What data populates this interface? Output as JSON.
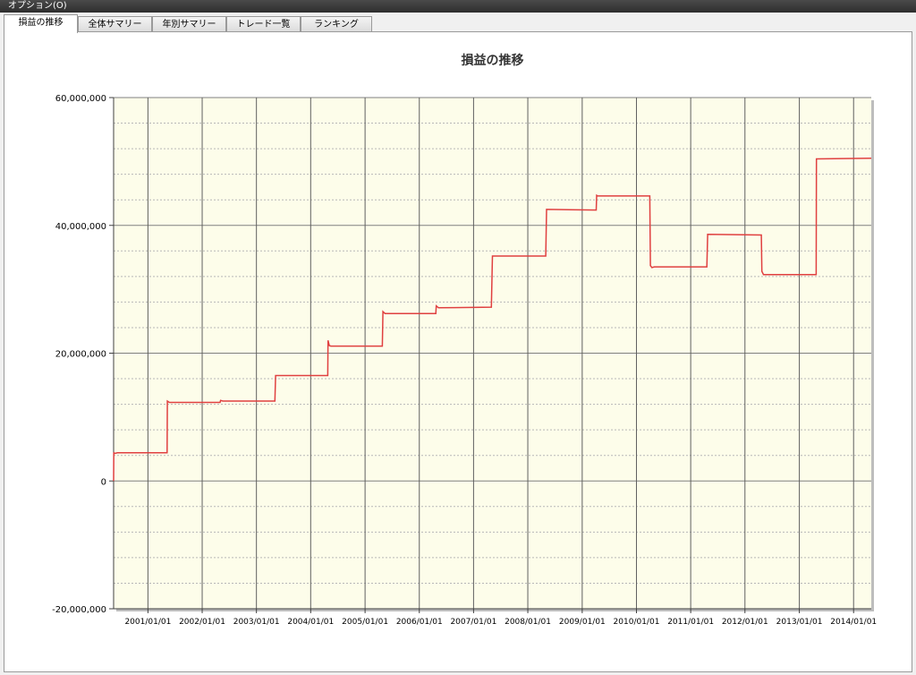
{
  "menu": {
    "options_label": "オプション(O)"
  },
  "tabs": [
    {
      "label": "損益の推移",
      "active": true
    },
    {
      "label": "全体サマリー",
      "active": false
    },
    {
      "label": "年別サマリー",
      "active": false
    },
    {
      "label": "トレード一覧",
      "active": false
    },
    {
      "label": "ランキング",
      "active": false
    }
  ],
  "colors": {
    "plot_background": "#fdfdea",
    "line": "#e04040",
    "grid": "#808080"
  },
  "chart_data": {
    "type": "line",
    "title": "損益の推移",
    "xlabel": "",
    "ylabel": "",
    "ylim": [
      -20000000,
      60000000
    ],
    "xlim": [
      "2000-05-15",
      "2014-04-30"
    ],
    "y_ticks": [
      -20000000,
      0,
      20000000,
      40000000,
      60000000
    ],
    "y_tick_labels": [
      "-20,000,000",
      "0",
      "20,000,000",
      "40,000,000",
      "60,000,000"
    ],
    "x_ticks": [
      "2001-01-01",
      "2002-01-01",
      "2003-01-01",
      "2004-01-01",
      "2005-01-01",
      "2006-01-01",
      "2007-01-01",
      "2008-01-01",
      "2009-01-01",
      "2010-01-01",
      "2011-01-01",
      "2012-01-01",
      "2013-01-01",
      "2014-01-01"
    ],
    "x_tick_labels": [
      "2001/01/01",
      "2002/01/01",
      "2003/01/01",
      "2004/01/01",
      "2005/01/01",
      "2006/01/01",
      "2007/01/01",
      "2008/01/01",
      "2009/01/01",
      "2010/01/01",
      "2011/01/01",
      "2012/01/01",
      "2013/01/01",
      "2014/01/01"
    ],
    "grid": true,
    "series": [
      {
        "x": [
          "2000-05-15",
          "2000-05-16",
          "2000-05-20",
          "2000-06-10",
          "2001-05-10",
          "2001-05-12",
          "2001-05-25",
          "2002-05-01",
          "2002-05-05",
          "2002-05-20",
          "2003-05-05",
          "2003-05-10",
          "2004-04-25",
          "2004-04-27",
          "2004-05-05",
          "2004-05-15",
          "2005-04-27",
          "2005-05-01",
          "2005-05-15",
          "2006-04-22",
          "2006-04-25",
          "2006-05-10",
          "2007-05-01",
          "2007-05-08",
          "2008-05-01",
          "2008-05-06",
          "2009-04-05",
          "2009-04-08",
          "2009-04-15",
          "2010-04-01",
          "2010-04-05",
          "2010-04-15",
          "2010-05-01",
          "2011-04-20",
          "2011-04-25",
          "2012-04-20",
          "2012-04-24",
          "2012-05-05",
          "2013-04-24",
          "2013-04-26",
          "2014-04-30"
        ],
        "y": [
          0,
          4500000,
          4300000,
          4400000,
          4400000,
          12500000,
          12300000,
          12300000,
          12600000,
          12500000,
          12500000,
          16500000,
          16500000,
          22000000,
          21200000,
          21100000,
          21100000,
          26500000,
          26200000,
          26200000,
          27400000,
          27100000,
          27200000,
          35200000,
          35200000,
          42500000,
          42400000,
          44700000,
          44600000,
          44600000,
          33700000,
          33400000,
          33500000,
          33500000,
          38600000,
          38500000,
          32800000,
          32300000,
          32300000,
          50400000,
          50500000
        ]
      }
    ]
  }
}
